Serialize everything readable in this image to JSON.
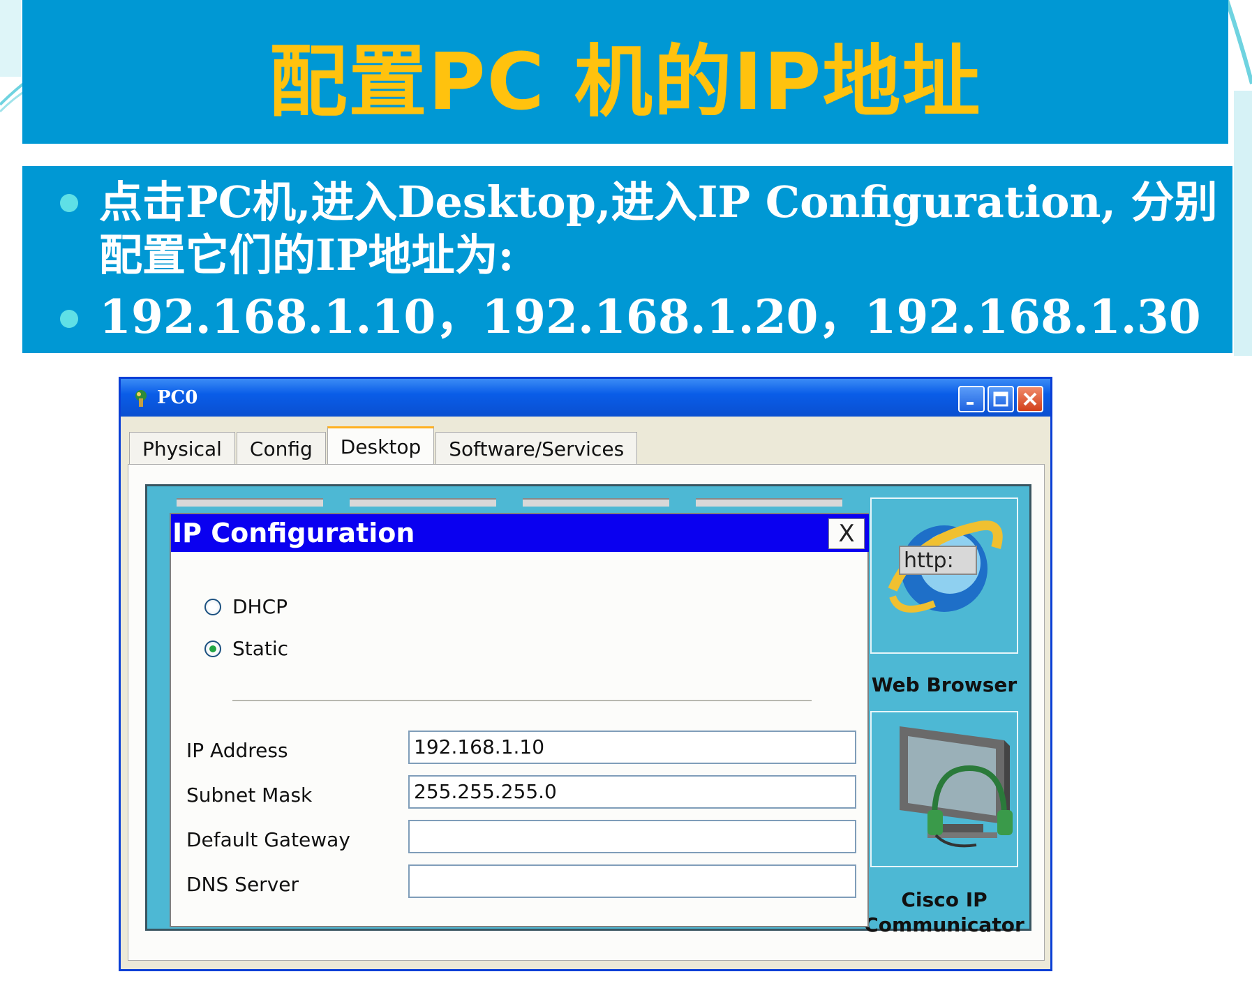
{
  "slide": {
    "title": "配置PC 机的IP地址",
    "bullets": [
      "点击PC机,进入Desktop,进入IP Configuration, 分别配置它们的IP地址为:",
      "192.168.1.10，192.168.1.20，192.168.1.30"
    ]
  },
  "window": {
    "title": "PC0",
    "buttons": {
      "minimize": "minimize-icon",
      "maximize": "maximize-icon",
      "close": "close-icon"
    },
    "tabs": [
      {
        "label": "Physical",
        "active": false
      },
      {
        "label": "Config",
        "active": false
      },
      {
        "label": "Desktop",
        "active": true
      },
      {
        "label": "Software/Services",
        "active": false
      }
    ]
  },
  "desktop": {
    "apps": [
      {
        "label": "Web Browser",
        "icon": "web-browser-icon",
        "icon_text": "http:"
      },
      {
        "label_line1": "Cisco IP",
        "label_line2": "Communicator",
        "icon": "ip-phone-monitor-icon"
      }
    ]
  },
  "ip_config": {
    "title": "IP Configuration",
    "close_label": "X",
    "mode_options": [
      {
        "label": "DHCP",
        "selected": false
      },
      {
        "label": "Static",
        "selected": true
      }
    ],
    "fields": [
      {
        "label": "IP Address",
        "value": "192.168.1.10"
      },
      {
        "label": "Subnet Mask",
        "value": "255.255.255.0"
      },
      {
        "label": "Default Gateway",
        "value": ""
      },
      {
        "label": "DNS Server",
        "value": ""
      }
    ]
  },
  "colors": {
    "band": "#0098d4",
    "title_text": "#ffc20e",
    "dialog_title": "#0a00f0",
    "desktop_bg": "#4db8d4",
    "bullet_dot": "#5fe0e6"
  }
}
